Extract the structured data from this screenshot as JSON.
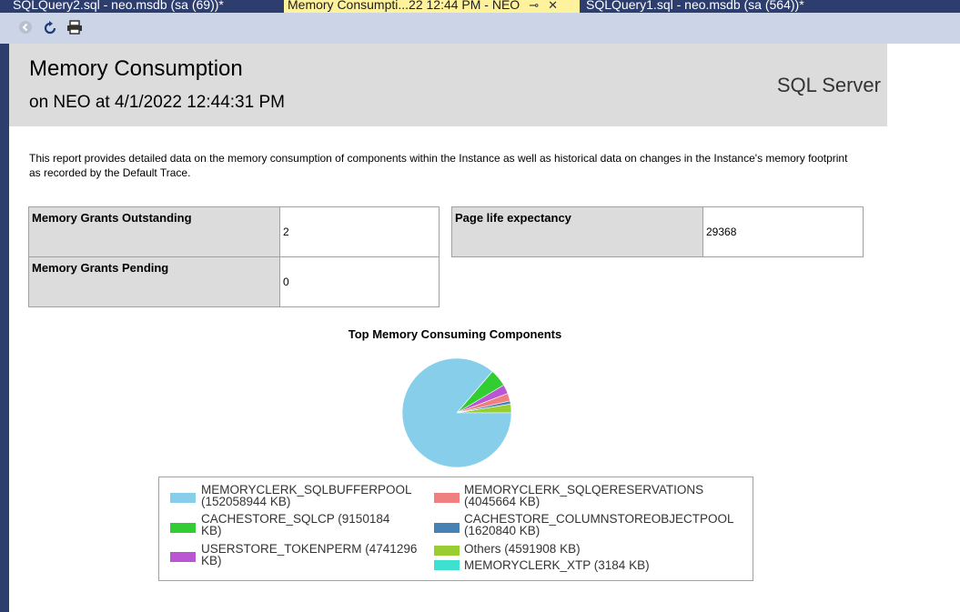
{
  "tabs": [
    {
      "label": "SQLQuery2.sql - neo.msdb (sa (69))*"
    },
    {
      "label": "Memory Consumpti...22 12:44 PM - NEO"
    },
    {
      "label": "SQLQuery1.sql - neo.msdb (sa (564))*"
    }
  ],
  "toolbar": {
    "icons": [
      "back-icon",
      "refresh-icon",
      "print-icon"
    ]
  },
  "report": {
    "title": "Memory Consumption",
    "subtitle": "on NEO at 4/1/2022 12:44:31 PM",
    "brand": "SQL Server",
    "description": "This report provides detailed data on the memory consumption of components within the Instance as well as historical data on changes in the Instance's memory footprint as recorded by the Default Trace."
  },
  "metrics": {
    "grants_outstanding": {
      "label": "Memory Grants Outstanding",
      "value": "2"
    },
    "grants_pending": {
      "label": "Memory Grants Pending",
      "value": "0"
    },
    "page_life": {
      "label": "Page life expectancy",
      "value": "29368"
    }
  },
  "chart_data": {
    "type": "pie",
    "title": "Top Memory Consuming Components",
    "legend_position": "bottom",
    "slices": [
      {
        "label": "MEMORYCLERK_SQLBUFFERPOOL (152058944 KB)",
        "value": 152058944,
        "color": "#87ceeb"
      },
      {
        "label": "CACHESTORE_SQLCP (9150184 KB)",
        "value": 9150184,
        "color": "#32cd32"
      },
      {
        "label": "USERSTORE_TOKENPERM (4741296 KB)",
        "value": 4741296,
        "color": "#ba55d3"
      },
      {
        "label": "MEMORYCLERK_SQLQERESERVATIONS (4045664 KB)",
        "value": 4045664,
        "color": "#f08080"
      },
      {
        "label": "CACHESTORE_COLUMNSTOREOBJECTPOOL (1620840 KB)",
        "value": 1620840,
        "color": "#4682b4"
      },
      {
        "label": "Others (4591908 KB)",
        "value": 4591908,
        "color": "#9acd32"
      },
      {
        "label": "MEMORYCLERK_XTP (3184 KB)",
        "value": 3184,
        "color": "#40e0d0"
      }
    ]
  }
}
